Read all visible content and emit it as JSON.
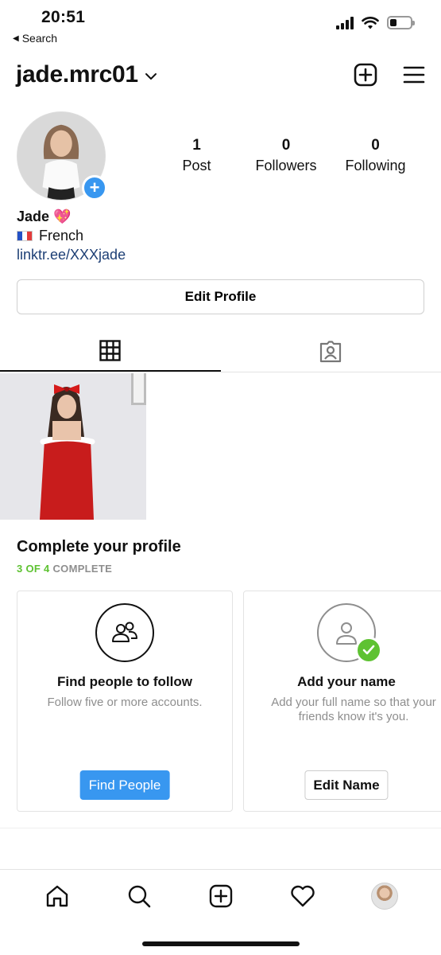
{
  "status_bar": {
    "time": "20:51",
    "back_label": "Search"
  },
  "header": {
    "username": "jade.mrc01",
    "icons": [
      "chevron-down-icon",
      "new-post-icon",
      "menu-icon"
    ]
  },
  "profile": {
    "stats": [
      {
        "value": "1",
        "label": "Post"
      },
      {
        "value": "0",
        "label": "Followers"
      },
      {
        "value": "0",
        "label": "Following"
      }
    ],
    "bio": {
      "name": "Jade 💖",
      "language": "French",
      "link": "linktr.ee/XXXjade"
    },
    "edit_profile_label": "Edit Profile"
  },
  "tabs": [
    "grid-icon",
    "tagged-icon"
  ],
  "complete_profile": {
    "title": "Complete your profile",
    "progress_done": "3 OF 4",
    "progress_suffix": "COMPLETE",
    "cards": [
      {
        "title": "Find people to follow",
        "description": "Follow five or more accounts.",
        "button": "Find People",
        "completed": false
      },
      {
        "title": "Add your name",
        "description": "Add your full name so that your friends know it's you.",
        "button": "Edit Name",
        "completed": true
      }
    ]
  },
  "bottom_nav": [
    "home-icon",
    "search-icon",
    "new-post-icon",
    "activity-heart-icon",
    "profile-avatar"
  ],
  "colors": {
    "accent": "#3897f0",
    "success": "#5ec232",
    "link": "#1d3f75",
    "muted": "#8e8e8e"
  }
}
